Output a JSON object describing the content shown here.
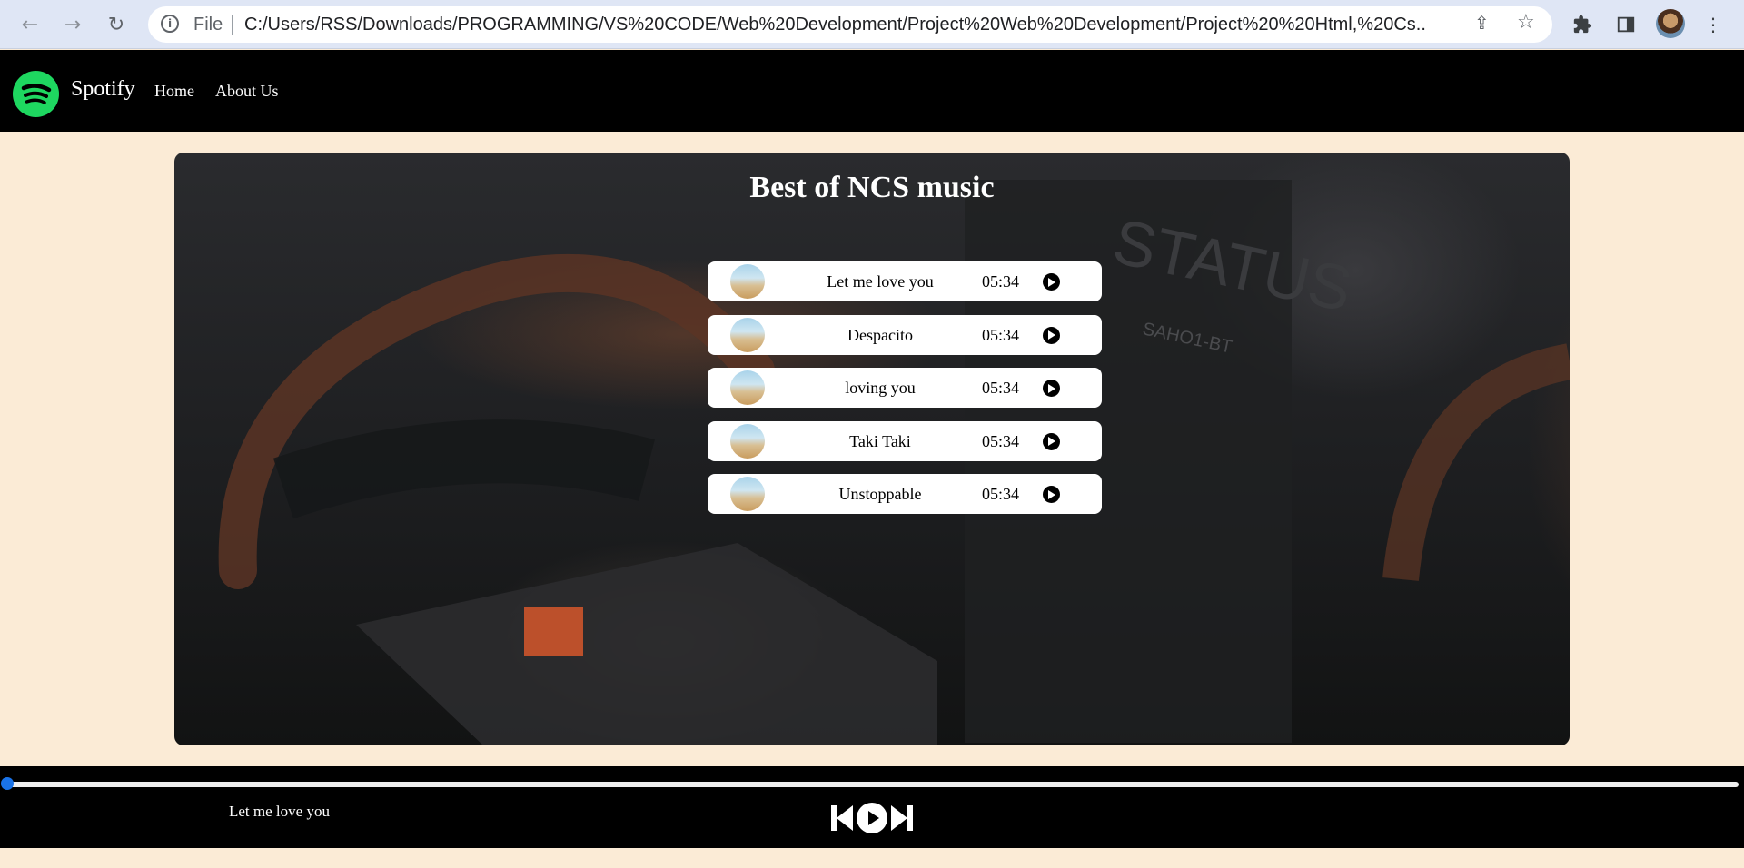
{
  "browser": {
    "file_label": "File",
    "url": "C:/Users/RSS/Downloads/PROGRAMMING/VS%20CODE/Web%20Development/Project%20Web%20Development/Project%20%20Html,%20Cs...",
    "icons": [
      "back-arrow-icon",
      "forward-arrow-icon",
      "reload-icon",
      "info-icon",
      "share-icon",
      "star-icon",
      "extensions-icon",
      "side-panel-icon",
      "profile-avatar",
      "menu-kebab-icon"
    ]
  },
  "navbar": {
    "brand": "Spotify",
    "links": [
      "Home",
      "About Us"
    ],
    "brand_color": "#1ed760"
  },
  "main": {
    "title": "Best of NCS music",
    "songs": [
      {
        "name": "Let me love you",
        "duration": "05:34"
      },
      {
        "name": "Despacito",
        "duration": "05:34"
      },
      {
        "name": "loving you",
        "duration": "05:34"
      },
      {
        "name": "Taki Taki",
        "duration": "05:34"
      },
      {
        "name": "Unstoppable",
        "duration": "05:34"
      }
    ]
  },
  "player": {
    "now_playing": "Let me love you",
    "progress": 0,
    "accent_color": "#1a73e8",
    "controls": [
      "previous-icon",
      "play-icon",
      "next-icon"
    ]
  }
}
